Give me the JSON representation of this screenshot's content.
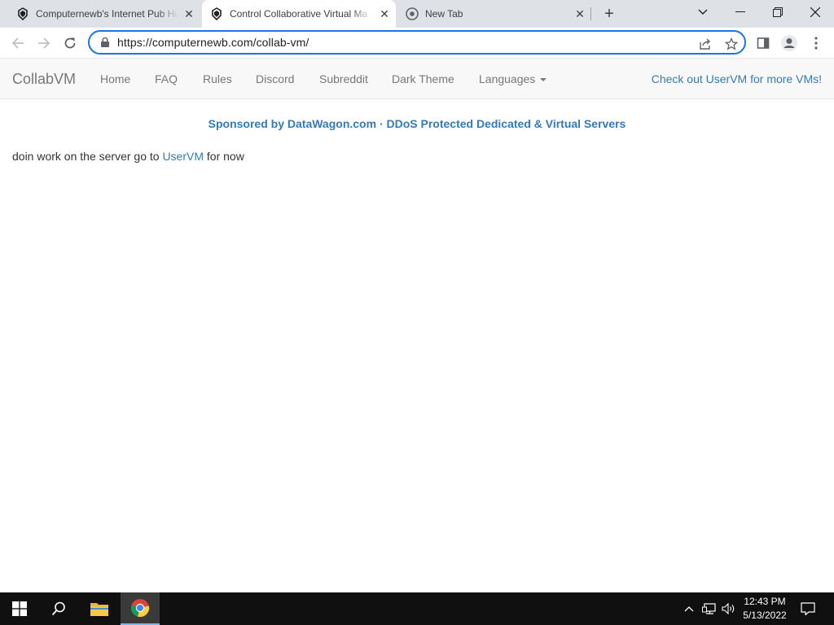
{
  "browser": {
    "tabs": [
      {
        "title": "Computernewb's Internet Pub Hu",
        "icon": "collabvm-icon",
        "active": false
      },
      {
        "title": "Control Collaborative Virtual Ma",
        "icon": "collabvm-icon",
        "active": true
      },
      {
        "title": "New Tab",
        "icon": "chrome-icon",
        "active": false
      }
    ],
    "url": "https://computernewb.com/collab-vm/"
  },
  "page": {
    "brand": "CollabVM",
    "nav": {
      "home": "Home",
      "faq": "FAQ",
      "rules": "Rules",
      "discord": "Discord",
      "subreddit": "Subreddit",
      "dark_theme": "Dark Theme",
      "languages": "Languages"
    },
    "nav_right": "Check out UserVM for more VMs!",
    "sponsor": {
      "left": "Sponsored by DataWagon.com",
      "separator": "·",
      "right": "DDoS Protected Dedicated & Virtual Servers"
    },
    "body": {
      "before": "doin work on the server go to ",
      "link": "UserVM",
      "after": " for now"
    }
  },
  "taskbar": {
    "time": "12:43 PM",
    "date": "5/13/2022"
  },
  "colors": {
    "link": "#337ab7",
    "omnibox_focus": "#1a73e8",
    "taskbar": "#101010"
  }
}
